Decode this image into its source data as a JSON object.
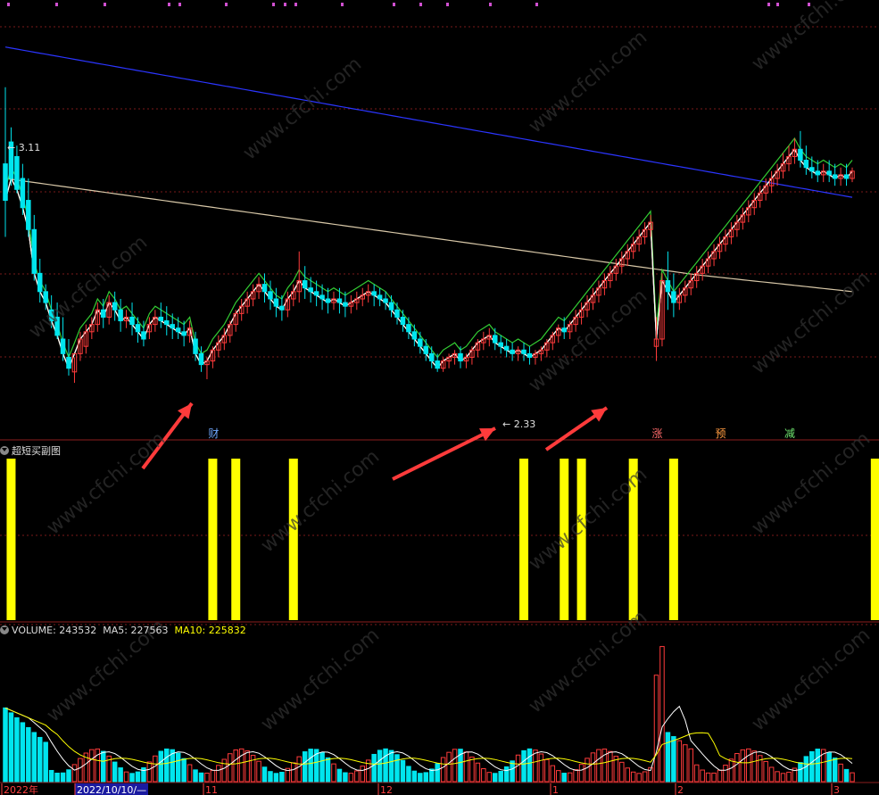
{
  "chart_data": [
    {
      "type": "candlestick",
      "title": "",
      "ylim": [
        2.2,
        3.3
      ],
      "price_labels": {
        "high": "3.11",
        "low": "2.33"
      },
      "event_labels": [
        {
          "text": "财",
          "color": "#6fa8ff",
          "bar": 36
        },
        {
          "text": "涨",
          "color": "#ff6a6a",
          "bar": 113
        },
        {
          "text": "预",
          "color": "#ff9a40",
          "bar": 124
        },
        {
          "text": "减",
          "color": "#6fe46f",
          "bar": 136
        }
      ],
      "candles": [
        [
          2.9,
          3.11,
          2.8,
          2.7
        ],
        [
          2.96,
          3.0,
          2.86,
          2.84
        ],
        [
          2.92,
          2.95,
          2.83,
          2.82
        ],
        [
          2.86,
          2.9,
          2.78,
          2.76
        ],
        [
          2.8,
          2.86,
          2.72,
          2.7
        ],
        [
          2.72,
          2.76,
          2.6,
          2.58
        ],
        [
          2.6,
          2.64,
          2.55,
          2.52
        ],
        [
          2.55,
          2.57,
          2.52,
          2.5
        ],
        [
          2.5,
          2.54,
          2.47,
          2.45
        ],
        [
          2.48,
          2.52,
          2.43,
          2.42
        ],
        [
          2.42,
          2.48,
          2.38,
          2.36
        ],
        [
          2.37,
          2.42,
          2.34,
          2.32
        ],
        [
          2.33,
          2.37,
          2.38,
          2.3
        ],
        [
          2.38,
          2.44,
          2.42,
          2.36
        ],
        [
          2.4,
          2.46,
          2.44,
          2.38
        ],
        [
          2.44,
          2.48,
          2.46,
          2.42
        ],
        [
          2.46,
          2.52,
          2.5,
          2.44
        ],
        [
          2.5,
          2.53,
          2.48,
          2.45
        ],
        [
          2.48,
          2.54,
          2.52,
          2.46
        ],
        [
          2.52,
          2.55,
          2.5,
          2.47
        ],
        [
          2.5,
          2.53,
          2.47,
          2.44
        ],
        [
          2.47,
          2.5,
          2.48,
          2.45
        ],
        [
          2.48,
          2.52,
          2.46,
          2.43
        ],
        [
          2.46,
          2.48,
          2.44,
          2.41
        ],
        [
          2.44,
          2.47,
          2.42,
          2.4
        ],
        [
          2.44,
          2.48,
          2.46,
          2.42
        ],
        [
          2.46,
          2.5,
          2.48,
          2.44
        ],
        [
          2.48,
          2.52,
          2.47,
          2.45
        ],
        [
          2.47,
          2.51,
          2.46,
          2.43
        ],
        [
          2.46,
          2.49,
          2.45,
          2.42
        ],
        [
          2.45,
          2.48,
          2.44,
          2.42
        ],
        [
          2.44,
          2.47,
          2.43,
          2.4
        ],
        [
          2.43,
          2.47,
          2.45,
          2.41
        ],
        [
          2.42,
          2.44,
          2.38,
          2.36
        ],
        [
          2.38,
          2.4,
          2.35,
          2.33
        ],
        [
          2.35,
          2.37,
          2.36,
          2.31
        ],
        [
          2.36,
          2.4,
          2.39,
          2.34
        ],
        [
          2.39,
          2.43,
          2.41,
          2.37
        ],
        [
          2.41,
          2.45,
          2.43,
          2.39
        ],
        [
          2.43,
          2.47,
          2.46,
          2.41
        ],
        [
          2.46,
          2.5,
          2.49,
          2.44
        ],
        [
          2.49,
          2.53,
          2.51,
          2.47
        ],
        [
          2.51,
          2.55,
          2.53,
          2.49
        ],
        [
          2.53,
          2.57,
          2.55,
          2.51
        ],
        [
          2.55,
          2.59,
          2.57,
          2.53
        ],
        [
          2.57,
          2.6,
          2.55,
          2.52
        ],
        [
          2.55,
          2.58,
          2.53,
          2.5
        ],
        [
          2.53,
          2.56,
          2.51,
          2.48
        ],
        [
          2.51,
          2.54,
          2.5,
          2.47
        ],
        [
          2.5,
          2.55,
          2.53,
          2.48
        ],
        [
          2.53,
          2.57,
          2.55,
          2.51
        ],
        [
          2.55,
          2.66,
          2.58,
          2.52
        ],
        [
          2.58,
          2.62,
          2.56,
          2.53
        ],
        [
          2.56,
          2.59,
          2.55,
          2.52
        ],
        [
          2.55,
          2.58,
          2.54,
          2.51
        ],
        [
          2.54,
          2.57,
          2.53,
          2.5
        ],
        [
          2.53,
          2.56,
          2.52,
          2.49
        ],
        [
          2.52,
          2.55,
          2.53,
          2.5
        ],
        [
          2.53,
          2.56,
          2.52,
          2.49
        ],
        [
          2.52,
          2.55,
          2.51,
          2.48
        ],
        [
          2.51,
          2.54,
          2.52,
          2.49
        ],
        [
          2.52,
          2.55,
          2.53,
          2.5
        ],
        [
          2.53,
          2.56,
          2.54,
          2.51
        ],
        [
          2.54,
          2.57,
          2.55,
          2.52
        ],
        [
          2.55,
          2.57,
          2.54,
          2.51
        ],
        [
          2.54,
          2.56,
          2.53,
          2.51
        ],
        [
          2.53,
          2.55,
          2.52,
          2.5
        ],
        [
          2.52,
          2.54,
          2.5,
          2.48
        ],
        [
          2.5,
          2.52,
          2.48,
          2.46
        ],
        [
          2.48,
          2.5,
          2.46,
          2.44
        ],
        [
          2.46,
          2.48,
          2.44,
          2.42
        ],
        [
          2.44,
          2.46,
          2.42,
          2.4
        ],
        [
          2.42,
          2.44,
          2.4,
          2.38
        ],
        [
          2.4,
          2.42,
          2.38,
          2.36
        ],
        [
          2.38,
          2.4,
          2.36,
          2.34
        ],
        [
          2.36,
          2.38,
          2.34,
          2.33
        ],
        [
          2.34,
          2.37,
          2.36,
          2.33
        ],
        [
          2.36,
          2.38,
          2.37,
          2.34
        ],
        [
          2.37,
          2.39,
          2.38,
          2.35
        ],
        [
          2.38,
          2.4,
          2.36,
          2.34
        ],
        [
          2.36,
          2.38,
          2.37,
          2.34
        ],
        [
          2.37,
          2.4,
          2.39,
          2.35
        ],
        [
          2.39,
          2.42,
          2.41,
          2.37
        ],
        [
          2.41,
          2.44,
          2.42,
          2.39
        ],
        [
          2.42,
          2.45,
          2.43,
          2.4
        ],
        [
          2.43,
          2.45,
          2.41,
          2.39
        ],
        [
          2.41,
          2.43,
          2.4,
          2.38
        ],
        [
          2.4,
          2.42,
          2.39,
          2.37
        ],
        [
          2.39,
          2.41,
          2.38,
          2.36
        ],
        [
          2.38,
          2.4,
          2.39,
          2.36
        ],
        [
          2.39,
          2.41,
          2.38,
          2.36
        ],
        [
          2.38,
          2.4,
          2.37,
          2.35
        ],
        [
          2.37,
          2.39,
          2.38,
          2.35
        ],
        [
          2.38,
          2.4,
          2.39,
          2.36
        ],
        [
          2.39,
          2.42,
          2.41,
          2.37
        ],
        [
          2.41,
          2.44,
          2.43,
          2.39
        ],
        [
          2.43,
          2.46,
          2.45,
          2.41
        ],
        [
          2.45,
          2.48,
          2.44,
          2.42
        ],
        [
          2.44,
          2.47,
          2.46,
          2.42
        ],
        [
          2.46,
          2.5,
          2.48,
          2.44
        ],
        [
          2.48,
          2.52,
          2.5,
          2.46
        ],
        [
          2.5,
          2.54,
          2.52,
          2.48
        ],
        [
          2.52,
          2.56,
          2.54,
          2.5
        ],
        [
          2.54,
          2.58,
          2.56,
          2.52
        ],
        [
          2.56,
          2.6,
          2.58,
          2.54
        ],
        [
          2.58,
          2.62,
          2.6,
          2.56
        ],
        [
          2.6,
          2.64,
          2.62,
          2.58
        ],
        [
          2.62,
          2.66,
          2.64,
          2.6
        ],
        [
          2.64,
          2.68,
          2.66,
          2.62
        ],
        [
          2.66,
          2.7,
          2.68,
          2.64
        ],
        [
          2.68,
          2.72,
          2.7,
          2.66
        ],
        [
          2.7,
          2.74,
          2.72,
          2.68
        ],
        [
          2.72,
          2.76,
          2.74,
          2.7
        ],
        [
          2.4,
          2.48,
          2.42,
          2.36
        ],
        [
          2.42,
          2.6,
          2.58,
          2.4
        ],
        [
          2.58,
          2.66,
          2.55,
          2.5
        ],
        [
          2.55,
          2.6,
          2.52,
          2.48
        ],
        [
          2.52,
          2.56,
          2.54,
          2.5
        ],
        [
          2.54,
          2.58,
          2.56,
          2.52
        ],
        [
          2.56,
          2.6,
          2.58,
          2.54
        ],
        [
          2.58,
          2.62,
          2.6,
          2.56
        ],
        [
          2.6,
          2.64,
          2.62,
          2.58
        ],
        [
          2.62,
          2.66,
          2.64,
          2.6
        ],
        [
          2.64,
          2.68,
          2.66,
          2.62
        ],
        [
          2.66,
          2.7,
          2.68,
          2.64
        ],
        [
          2.68,
          2.72,
          2.7,
          2.66
        ],
        [
          2.7,
          2.74,
          2.72,
          2.68
        ],
        [
          2.72,
          2.76,
          2.74,
          2.7
        ],
        [
          2.74,
          2.78,
          2.76,
          2.72
        ],
        [
          2.76,
          2.8,
          2.78,
          2.74
        ],
        [
          2.78,
          2.82,
          2.8,
          2.76
        ],
        [
          2.8,
          2.84,
          2.82,
          2.78
        ],
        [
          2.82,
          2.86,
          2.84,
          2.8
        ],
        [
          2.84,
          2.88,
          2.86,
          2.82
        ],
        [
          2.86,
          2.9,
          2.88,
          2.84
        ],
        [
          2.88,
          2.93,
          2.9,
          2.86
        ],
        [
          2.9,
          2.95,
          2.92,
          2.88
        ],
        [
          2.92,
          2.97,
          2.94,
          2.9
        ],
        [
          2.94,
          2.99,
          2.91,
          2.89
        ],
        [
          2.91,
          2.95,
          2.89,
          2.87
        ],
        [
          2.89,
          2.92,
          2.88,
          2.86
        ],
        [
          2.88,
          2.91,
          2.87,
          2.85
        ],
        [
          2.87,
          2.9,
          2.88,
          2.85
        ],
        [
          2.88,
          2.91,
          2.87,
          2.85
        ],
        [
          2.87,
          2.9,
          2.86,
          2.84
        ],
        [
          2.86,
          2.89,
          2.87,
          2.84
        ],
        [
          2.87,
          2.9,
          2.86,
          2.84
        ],
        [
          2.86,
          2.89,
          2.88,
          2.85
        ]
      ]
    },
    {
      "type": "bar",
      "title": "超短买副图",
      "signal_bars": [
        1,
        36,
        40,
        50,
        90,
        97,
        100,
        109,
        116,
        151
      ],
      "signal_color": "#ffff00"
    },
    {
      "type": "bar",
      "title": "VOLUME",
      "stats": {
        "volume": "243532",
        "ma5": "227563",
        "ma10": "225832"
      },
      "ma5_color": "#ffffff",
      "ma10_color": "#ffff00"
    }
  ],
  "xaxis": {
    "labels": [
      "2022年",
      "2022/10/10/—",
      "11",
      "12",
      "1",
      "2",
      "3"
    ]
  },
  "watermark": "www.cfchi.com"
}
